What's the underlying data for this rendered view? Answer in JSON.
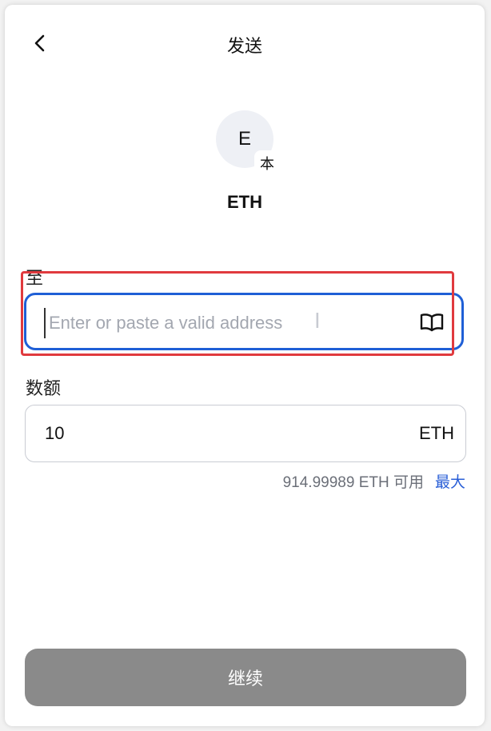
{
  "header": {
    "title": "发送"
  },
  "token": {
    "avatar_letter": "E",
    "network_badge": "本",
    "name": "ETH"
  },
  "recipient": {
    "label": "至",
    "value": "",
    "placeholder": "Enter or paste a valid address"
  },
  "amount": {
    "label": "数额",
    "value": "10",
    "unit": "ETH",
    "available_text": "914.99989 ETH 可用",
    "max_label": "最大"
  },
  "footer": {
    "continue_label": "继续"
  },
  "colors": {
    "focus_border": "#1f5fd6",
    "highlight_border": "#e03a3e",
    "link": "#2a5fd7",
    "button_disabled": "#8a8a8a"
  },
  "icons": {
    "back": "chevron-left-icon",
    "address_book": "book-icon",
    "text_cursor": "text-cursor-icon"
  }
}
